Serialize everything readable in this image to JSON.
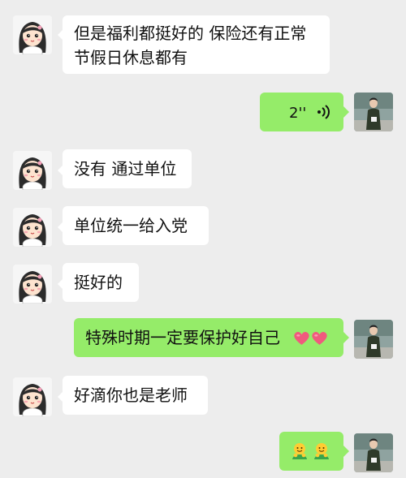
{
  "chat": {
    "messages": [
      {
        "side": "left",
        "text_line1": "但是福利都挺好的 保险还有正常",
        "text_line2": "节假日休息都有"
      },
      {
        "side": "right",
        "type": "voice",
        "duration": "2''"
      },
      {
        "side": "left",
        "text": "没有 通过单位"
      },
      {
        "side": "left",
        "text": "单位统一给入党"
      },
      {
        "side": "left",
        "text": "挺好的"
      },
      {
        "side": "right",
        "text": "特殊时期一定要保护好自己"
      },
      {
        "side": "left",
        "text": "好滴你也是老师"
      },
      {
        "side": "right",
        "type": "emoji"
      }
    ]
  },
  "icons": {
    "self_avatar": "girl-cartoon-avatar-icon",
    "other_avatar": "person-photo-avatar-icon",
    "voice": "voice-wave-icon",
    "heart": "red-heart-emoji",
    "hug": "hug-emoji"
  },
  "colors": {
    "background": "#ededed",
    "left_bubble": "#ffffff",
    "right_bubble": "#95ec69",
    "heart": "#f05a7e"
  }
}
